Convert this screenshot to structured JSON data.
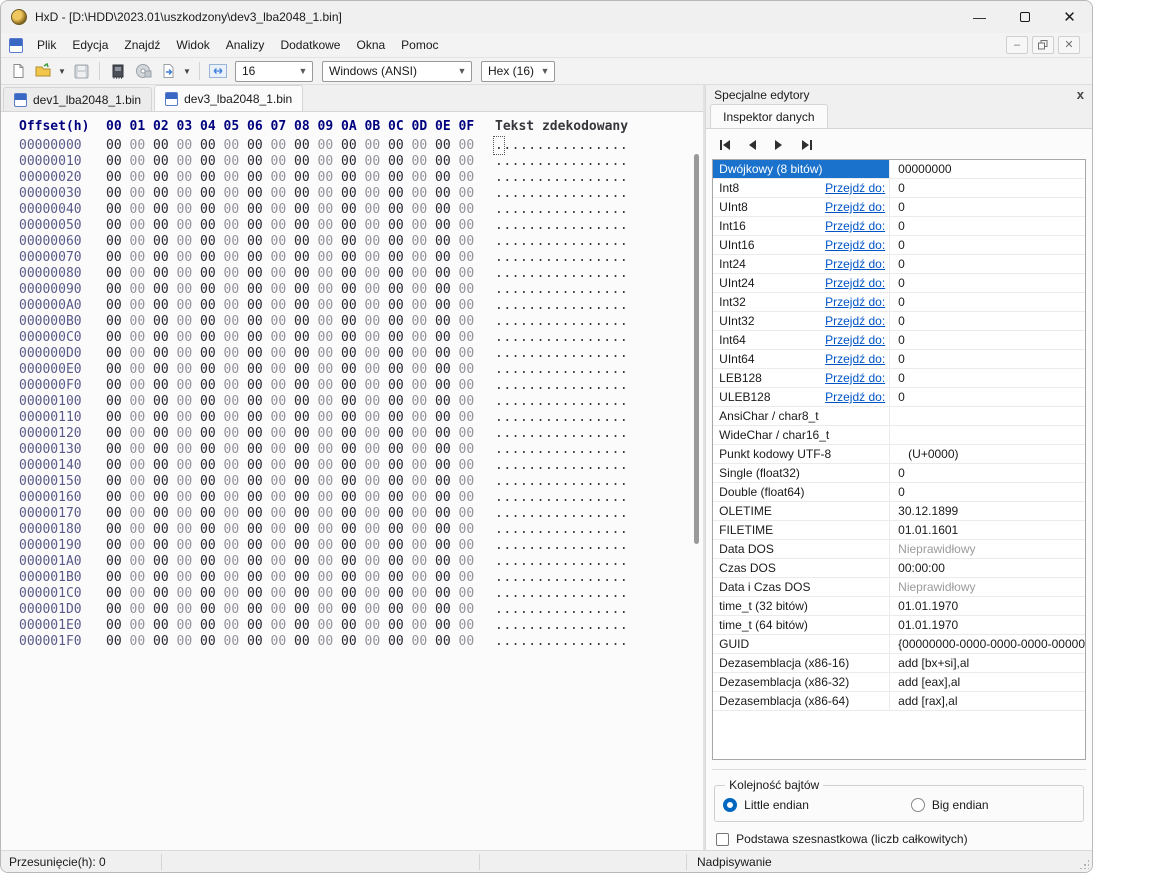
{
  "window": {
    "title": "HxD - [D:\\HDD\\2023.01\\uszkodzony\\dev3_lba2048_1.bin]"
  },
  "menu": {
    "items": [
      "Plik",
      "Edycja",
      "Znajdź",
      "Widok",
      "Analizy",
      "Dodatkowe",
      "Okna",
      "Pomoc"
    ]
  },
  "toolbar": {
    "bytes_per_row": "16",
    "encoding": "Windows (ANSI)",
    "base": "Hex (16)"
  },
  "tabs": [
    {
      "label": "dev1_lba2048_1.bin",
      "active": false
    },
    {
      "label": "dev3_lba2048_1.bin",
      "active": true
    }
  ],
  "hex": {
    "offset_header": "Offset(h)",
    "text_header": "Tekst zdekodowany",
    "col_headers": [
      "00",
      "01",
      "02",
      "03",
      "04",
      "05",
      "06",
      "07",
      "08",
      "09",
      "0A",
      "0B",
      "0C",
      "0D",
      "0E",
      "0F"
    ],
    "byte": "00",
    "decoded_text": "................",
    "cursor_row": 0,
    "offsets": [
      "00000000",
      "00000010",
      "00000020",
      "00000030",
      "00000040",
      "00000050",
      "00000060",
      "00000070",
      "00000080",
      "00000090",
      "000000A0",
      "000000B0",
      "000000C0",
      "000000D0",
      "000000E0",
      "000000F0",
      "00000100",
      "00000110",
      "00000120",
      "00000130",
      "00000140",
      "00000150",
      "00000160",
      "00000170",
      "00000180",
      "00000190",
      "000001A0",
      "000001B0",
      "000001C0",
      "000001D0",
      "000001E0",
      "000001F0"
    ]
  },
  "inspector": {
    "panel_title": "Specjalne edytory",
    "panel_close": "x",
    "tab": "Inspektor danych",
    "goto_label": "Przejdź do:",
    "rows": [
      {
        "name": "Dwójkowy (8 bitów)",
        "value": "00000000",
        "selected": true
      },
      {
        "name": "Int8",
        "goto": true,
        "value": "0"
      },
      {
        "name": "UInt8",
        "goto": true,
        "value": "0"
      },
      {
        "name": "Int16",
        "goto": true,
        "value": "0"
      },
      {
        "name": "UInt16",
        "goto": true,
        "value": "0"
      },
      {
        "name": "Int24",
        "goto": true,
        "value": "0"
      },
      {
        "name": "UInt24",
        "goto": true,
        "value": "0"
      },
      {
        "name": "Int32",
        "goto": true,
        "value": "0"
      },
      {
        "name": "UInt32",
        "goto": true,
        "value": "0"
      },
      {
        "name": "Int64",
        "goto": true,
        "value": "0"
      },
      {
        "name": "UInt64",
        "goto": true,
        "value": "0"
      },
      {
        "name": "LEB128",
        "goto": true,
        "value": "0"
      },
      {
        "name": "ULEB128",
        "goto": true,
        "value": "0"
      },
      {
        "name": "AnsiChar / char8_t",
        "value": ""
      },
      {
        "name": "WideChar / char16_t",
        "value": ""
      },
      {
        "name": "Punkt kodowy UTF-8",
        "value": "   (U+0000)"
      },
      {
        "name": "Single (float32)",
        "value": "0"
      },
      {
        "name": "Double (float64)",
        "value": "0"
      },
      {
        "name": "OLETIME",
        "value": "30.12.1899"
      },
      {
        "name": "FILETIME",
        "value": "01.01.1601"
      },
      {
        "name": "Data DOS",
        "value": "Nieprawidłowy",
        "muted": true
      },
      {
        "name": "Czas DOS",
        "value": "00:00:00"
      },
      {
        "name": "Data i Czas DOS",
        "value": "Nieprawidłowy",
        "muted": true
      },
      {
        "name": "time_t (32 bitów)",
        "value": "01.01.1970"
      },
      {
        "name": "time_t (64 bitów)",
        "value": "01.01.1970"
      },
      {
        "name": "GUID",
        "value": "{00000000-0000-0000-0000-00000"
      },
      {
        "name": "Dezasemblacja (x86-16)",
        "value": "add [bx+si],al"
      },
      {
        "name": "Dezasemblacja (x86-32)",
        "value": "add [eax],al"
      },
      {
        "name": "Dezasemblacja (x86-64)",
        "value": "add [rax],al"
      }
    ],
    "byte_order": {
      "legend": "Kolejność bajtów",
      "little": "Little endian",
      "big": "Big endian",
      "selected": "Little endian"
    },
    "hex_base_checkbox": "Podstawa szesnastkowa (liczb całkowitych)",
    "hex_base_checked": false
  },
  "status": {
    "offset_label": "Przesunięcie(h): 0",
    "mode": "Nadpisywanie"
  }
}
